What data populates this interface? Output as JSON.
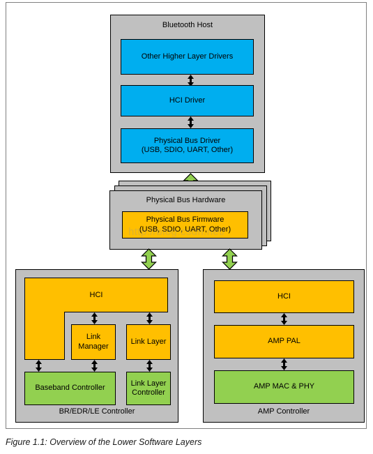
{
  "figure": {
    "caption": "Figure 1.1:  Overview of the Lower Software Layers",
    "watermark": "http://blog.csdn.net/"
  },
  "colors": {
    "panel_gray": "#c0c0c0",
    "blue": "#00aeef",
    "orange": "#ffbf00",
    "green": "#92d050",
    "outline": "#000000",
    "frame": "#808080",
    "arrow_green_fill": "#92d050",
    "arrow_black_fill": "#000000"
  },
  "host": {
    "title": "Bluetooth Host",
    "blocks": [
      {
        "label": "Other Higher Layer Drivers",
        "color": "blue"
      },
      {
        "label": "HCI Driver",
        "color": "blue"
      },
      {
        "label": "Physical Bus Driver\n(USB, SDIO, UART, Other)",
        "color": "blue"
      }
    ]
  },
  "physical_bus": {
    "title": "Physical Bus Hardware",
    "stacked": true,
    "stack_count": 3,
    "blocks": [
      {
        "label": "Physical Bus Firmware\n(USB, SDIO, UART, Other)",
        "color": "orange"
      }
    ]
  },
  "br_edr_le_controller": {
    "title": "BR/EDR/LE Controller",
    "blocks": [
      {
        "label": "HCI",
        "color": "orange"
      },
      {
        "label": "Link\nManager",
        "color": "orange"
      },
      {
        "label": "Link Layer",
        "color": "orange"
      },
      {
        "label": "Baseband Controller",
        "color": "green"
      },
      {
        "label": "Link Layer\nController",
        "color": "green"
      }
    ]
  },
  "amp_controller": {
    "title": "AMP Controller",
    "blocks": [
      {
        "label": "HCI",
        "color": "orange"
      },
      {
        "label": "AMP PAL",
        "color": "orange"
      },
      {
        "label": "AMP MAC & PHY",
        "color": "green"
      }
    ]
  },
  "arrows": {
    "host_internal": [
      {
        "name": "arrow-other-to-hci-driver",
        "direction": "bidirectional",
        "color": "black"
      },
      {
        "name": "arrow-hci-driver-to-phy-bus-driver",
        "direction": "bidirectional",
        "color": "black"
      }
    ],
    "host_to_bus": {
      "name": "arrow-host-to-physical-bus",
      "direction": "bidirectional",
      "color": "green"
    },
    "bus_to_controllers": [
      {
        "name": "arrow-bus-to-br-edr-le-controller",
        "direction": "bidirectional",
        "color": "green"
      },
      {
        "name": "arrow-bus-to-amp-controller",
        "direction": "bidirectional",
        "color": "green"
      }
    ],
    "br_internal": [
      {
        "name": "arrow-hci-to-link-manager",
        "direction": "bidirectional",
        "color": "black"
      },
      {
        "name": "arrow-hci-to-link-layer",
        "direction": "bidirectional",
        "color": "black"
      },
      {
        "name": "arrow-hci-to-baseband-controller",
        "direction": "bidirectional",
        "color": "black"
      },
      {
        "name": "arrow-link-manager-to-baseband-controller",
        "direction": "bidirectional",
        "color": "black"
      },
      {
        "name": "arrow-link-layer-to-link-layer-controller",
        "direction": "bidirectional",
        "color": "black"
      }
    ],
    "amp_internal": [
      {
        "name": "arrow-amp-hci-to-amp-pal",
        "direction": "bidirectional",
        "color": "black"
      },
      {
        "name": "arrow-amp-pal-to-amp-mac-phy",
        "direction": "bidirectional",
        "color": "black"
      }
    ]
  }
}
